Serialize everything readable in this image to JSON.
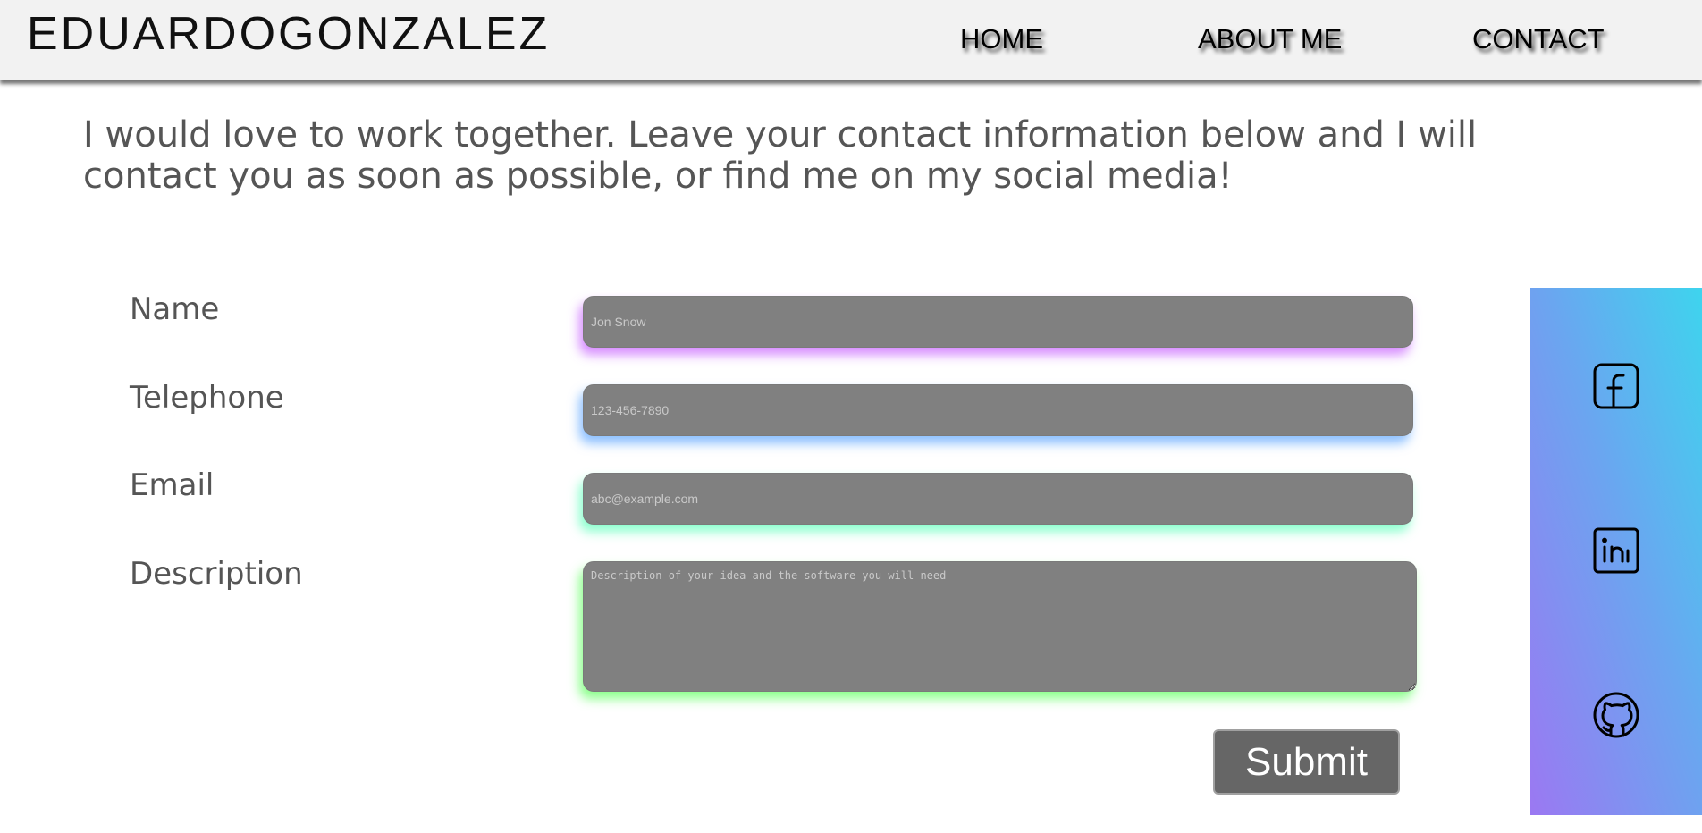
{
  "header": {
    "brand": "EDUARDOGONZALEZ",
    "nav": {
      "home": "HOME",
      "about": "ABOUT ME",
      "contact": "CONTACT"
    }
  },
  "intro": {
    "text": "I would love to work together. Leave your contact information below and I will contact you as soon as possible, or find me on my social media!"
  },
  "form": {
    "name": {
      "label": "Name",
      "value": "",
      "placeholder": "Jon Snow"
    },
    "telephone": {
      "label": "Telephone",
      "value": "",
      "placeholder": "123-456-7890"
    },
    "email": {
      "label": "Email",
      "value": "",
      "placeholder": "abc@example.com"
    },
    "description": {
      "label": "Description",
      "value": "",
      "placeholder": "Description of your idea and the software you will need"
    },
    "submit_label": "Submit"
  },
  "social": {
    "gradient_colors": [
      "#9b78f2",
      "#6aa6f0",
      "#3ed4ee"
    ],
    "items": [
      {
        "icon": "facebook-icon"
      },
      {
        "icon": "linkedin-icon"
      },
      {
        "icon": "github-icon"
      }
    ]
  },
  "colors": {
    "header_bg": "#f2f2f2",
    "field_bg": "#808080",
    "button_bg": "#666666",
    "text_gray": "#555555"
  }
}
